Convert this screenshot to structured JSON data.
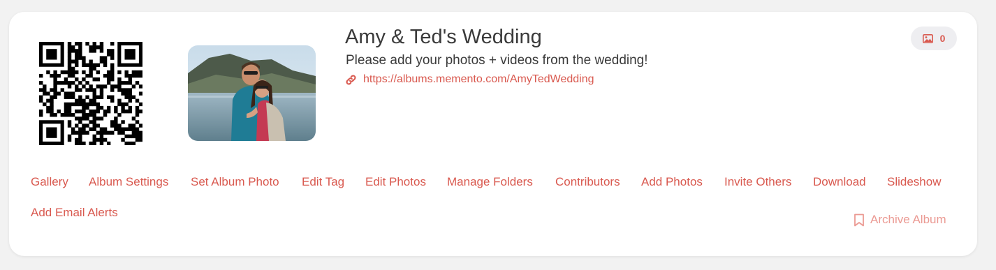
{
  "album": {
    "title": "Amy & Ted's Wedding",
    "subtitle": "Please add your photos + videos from the wedding!",
    "url": "https://albums.memento.com/AmyTedWedding",
    "photo_count": "0"
  },
  "nav": {
    "items": [
      "Gallery",
      "Album Settings",
      "Set Album Photo",
      "Edit Tag",
      "Edit Photos",
      "Manage Folders",
      "Contributors",
      "Add Photos",
      "Invite Others",
      "Download",
      "Slideshow",
      "Add Email Alerts"
    ],
    "archive_label": "Archive Album"
  },
  "icons": {
    "url": "link-icon",
    "count": "image-icon",
    "archive": "bookmark-icon"
  },
  "colors": {
    "accent": "#d9594f",
    "accent_light": "#eb9a93",
    "text": "#3a3a3a",
    "badge_bg": "#eeeef1"
  }
}
